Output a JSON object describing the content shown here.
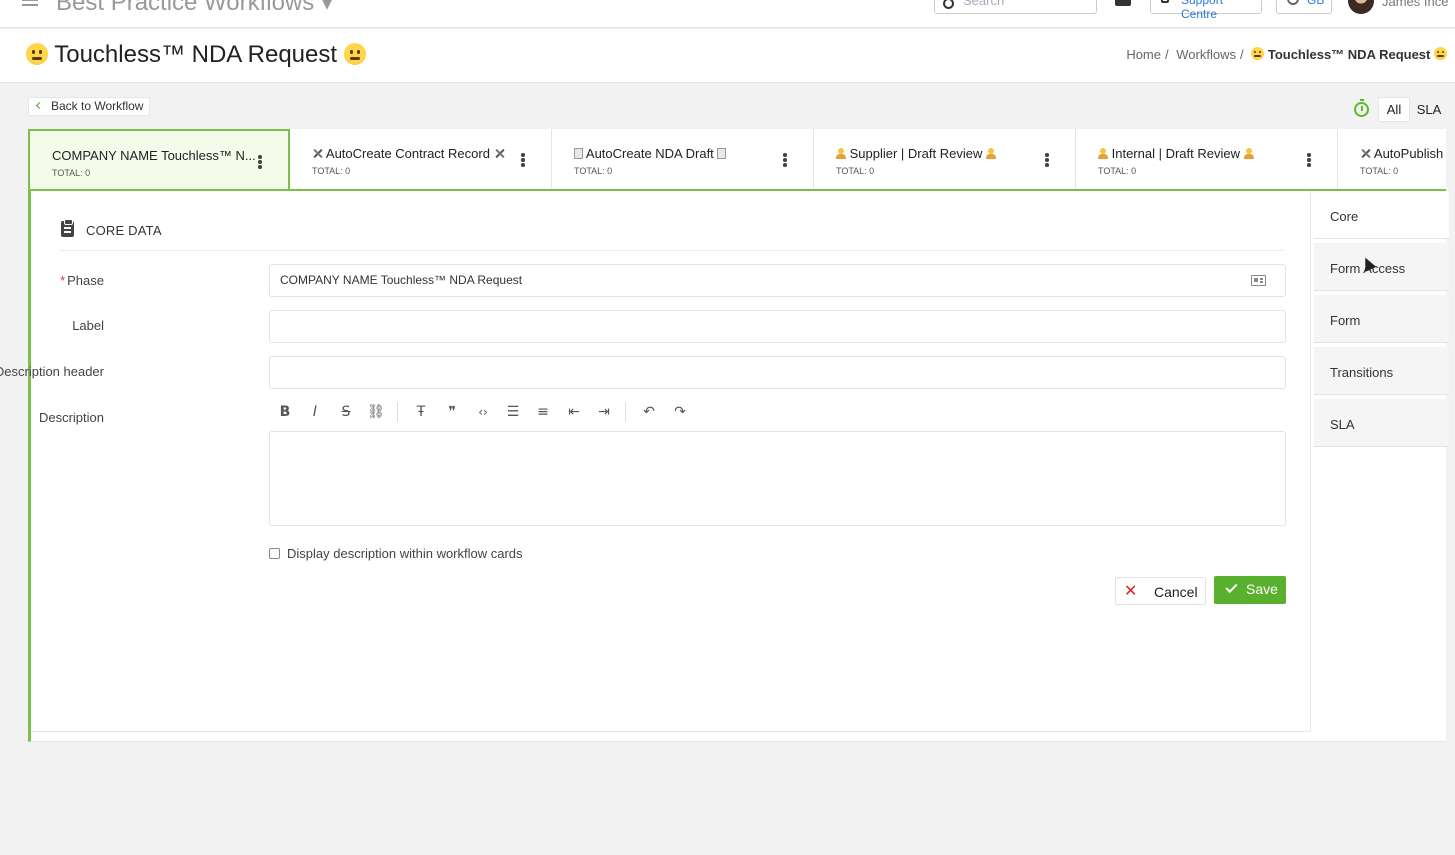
{
  "topbar": {
    "app_title": "Best Practice Workflows ▾",
    "search_placeholder": "Search",
    "support_label": "Support Centre",
    "lang_label": "GB",
    "user_name": "James Ince"
  },
  "header": {
    "title": "Touchless™ NDA Request",
    "breadcrumb": {
      "home": "Home",
      "workflows": "Workflows",
      "current": "Touchless™ NDA Request"
    }
  },
  "back_label": "Back to Workflow",
  "filters": {
    "all": "All",
    "sla": "SLA"
  },
  "phases": [
    {
      "name": "COMPANY NAME Touchless™ N...",
      "total": "TOTAL: 0",
      "icon": "none"
    },
    {
      "name": "AutoCreate Contract Record",
      "total": "TOTAL: 0",
      "icon": "tools-icon"
    },
    {
      "name": "AutoCreate NDA Draft",
      "total": "TOTAL: 0",
      "icon": "document-icon"
    },
    {
      "name": "Supplier | Draft Review",
      "total": "TOTAL: 0",
      "icon": "person-icon"
    },
    {
      "name": "Internal | Draft Review",
      "total": "TOTAL: 0",
      "icon": "person-icon"
    },
    {
      "name": "AutoPublish",
      "total": "TOTAL: 0",
      "icon": "tools-icon"
    }
  ],
  "core": {
    "section_title": "CORE DATA",
    "phase_label": "Phase",
    "phase_value": "COMPANY NAME Touchless™ NDA Request",
    "label_label": "Label",
    "label_value": "",
    "desc_header_label": "Description header",
    "desc_header_value": "",
    "description_label": "Description",
    "display_checkbox_label": "Display description within workflow cards",
    "cancel_label": "Cancel",
    "save_label": "Save"
  },
  "side_nav": [
    {
      "label": "Core",
      "active": true
    },
    {
      "label": "Form Access",
      "active": false
    },
    {
      "label": "Form",
      "active": false
    },
    {
      "label": "Transitions",
      "active": false
    },
    {
      "label": "SLA",
      "active": false
    }
  ],
  "colors": {
    "accent": "#59b02e",
    "tab_border": "#7cc04a",
    "danger": "#d22222"
  }
}
